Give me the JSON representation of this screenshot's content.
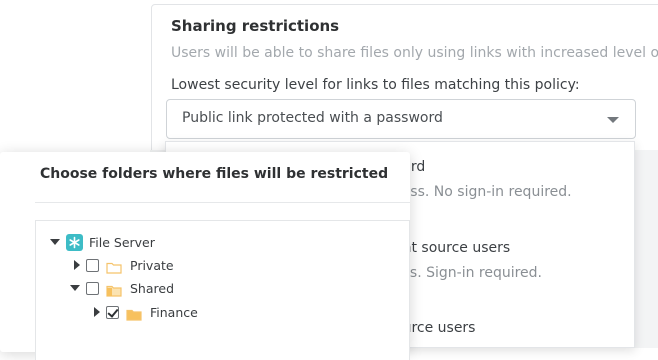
{
  "sharing": {
    "title": "Sharing restrictions",
    "description": "Users will be able to share files only using links with increased level of se",
    "label": "Lowest security level for links to files matching this policy:",
    "select_value": "Public link protected with a password"
  },
  "dropdown": {
    "options": [
      {
        "title": "vord",
        "desc": "cess. No sign-in required."
      },
      {
        "title": "ent source users",
        "desc": "ess. Sign-in required."
      },
      {
        "title": "ource users",
        "desc": ""
      }
    ]
  },
  "dialog": {
    "title": "Choose folders where files will be restricted",
    "tree": {
      "root": "File Server",
      "private": "Private",
      "shared": "Shared",
      "finance": "Finance"
    }
  },
  "colors": {
    "accent": "#3dbcc6",
    "folder_outline": "#f5c36b",
    "folder_fill": "#f7c15e"
  }
}
